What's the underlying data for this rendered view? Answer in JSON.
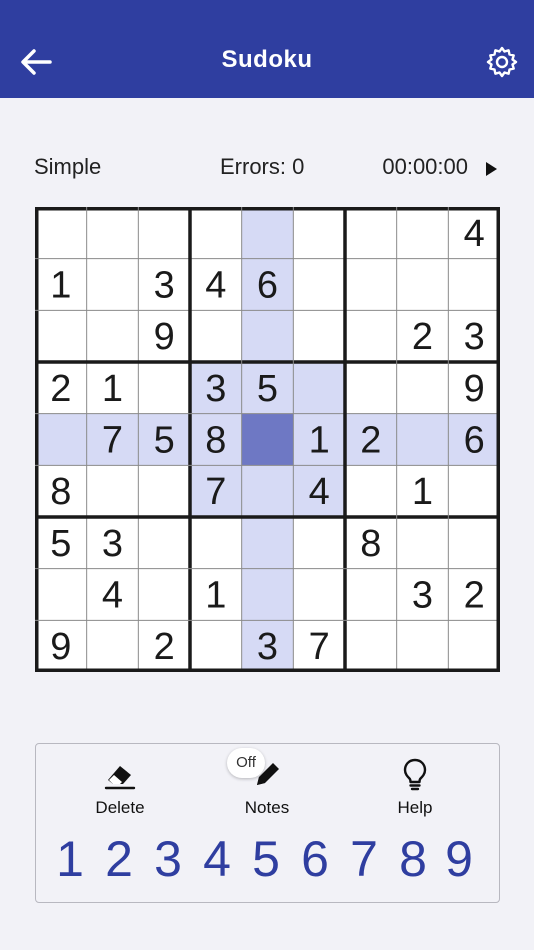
{
  "appbar": {
    "title": "Sudoku",
    "back_icon": "arrow-left-icon",
    "settings_icon": "gear-icon",
    "bg_color": "#2f3ea0"
  },
  "status": {
    "difficulty": "Simple",
    "errors": "Errors: 0",
    "timer": "00:00:00",
    "play_icon": "play-icon"
  },
  "board": {
    "grid": [
      [
        "",
        "",
        "",
        "",
        "",
        "",
        "",
        "",
        "4"
      ],
      [
        "1",
        "",
        "3",
        "4",
        "6",
        "",
        "",
        "",
        ""
      ],
      [
        "",
        "",
        "9",
        "",
        "",
        "",
        "",
        "2",
        "3"
      ],
      [
        "2",
        "1",
        "",
        "3",
        "5",
        "",
        "",
        "",
        "9"
      ],
      [
        "",
        "7",
        "5",
        "8",
        "",
        "1",
        "2",
        "",
        "6"
      ],
      [
        "8",
        "",
        "",
        "7",
        "",
        "4",
        "",
        "1",
        ""
      ],
      [
        "5",
        "3",
        "",
        "",
        "",
        "",
        "8",
        "",
        ""
      ],
      [
        "",
        "4",
        "",
        "1",
        "",
        "",
        "",
        "3",
        "2"
      ],
      [
        "9",
        "",
        "2",
        "",
        "3",
        "7",
        "",
        "",
        ""
      ]
    ],
    "selected": [
      4,
      4
    ],
    "highlight_color": "#d6daf5",
    "selected_color": "#6e78c4"
  },
  "tools": {
    "delete_label": "Delete",
    "notes_label": "Notes",
    "notes_state": "Off",
    "help_label": "Help",
    "delete_icon": "eraser-icon",
    "notes_icon": "pencil-icon",
    "help_icon": "lightbulb-icon"
  },
  "numpad": [
    "1",
    "2",
    "3",
    "4",
    "5",
    "6",
    "7",
    "8",
    "9"
  ]
}
